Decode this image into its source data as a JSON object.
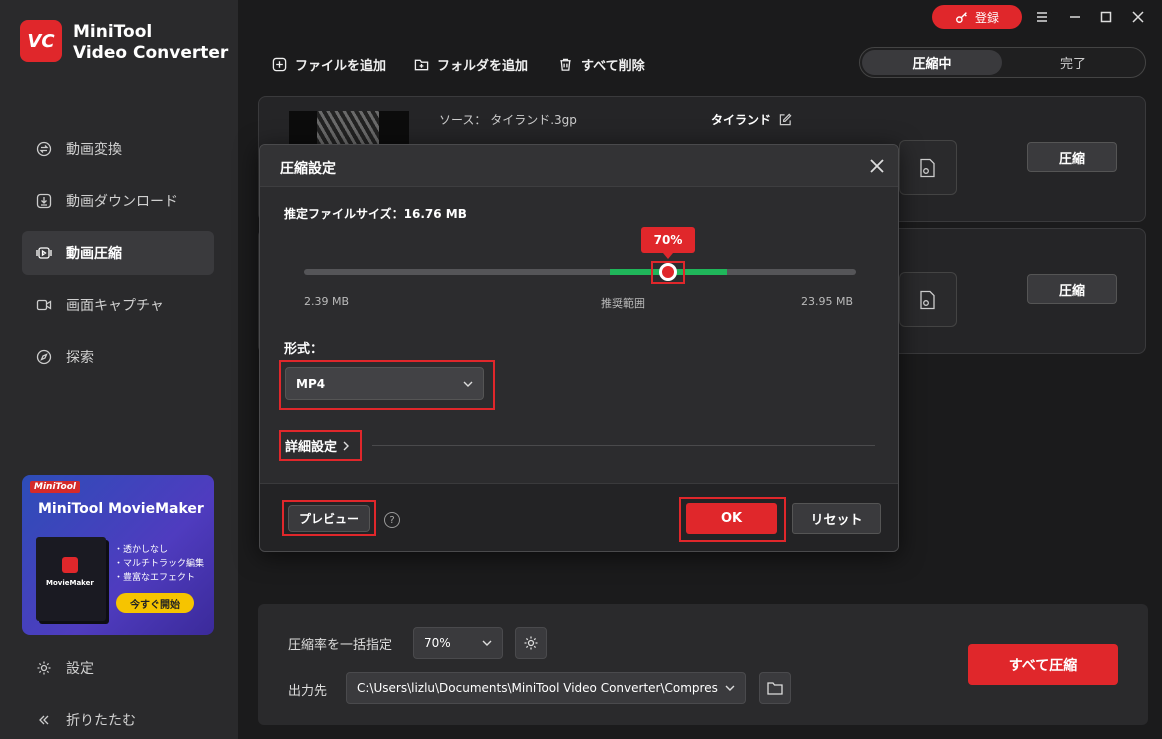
{
  "app": {
    "logo_text": "VC",
    "name_line1": "MiniTool",
    "name_line2": "Video Converter"
  },
  "sidebar": {
    "items": [
      {
        "label": "動画変換",
        "icon": "convert-icon"
      },
      {
        "label": "動画ダウンロード",
        "icon": "download-icon"
      },
      {
        "label": "動画圧縮",
        "icon": "compress-icon",
        "active": true
      },
      {
        "label": "画面キャプチャ",
        "icon": "camera-icon"
      },
      {
        "label": "探索",
        "icon": "compass-icon"
      }
    ],
    "settings_label": "設定",
    "collapse_label": "折りたたむ"
  },
  "promo": {
    "brand": "MiniTool",
    "title": "MiniTool MovieMaker",
    "box_text": "MovieMaker",
    "features": [
      "・透かしなし",
      "・マルチトラック編集",
      "・豊富なエフェクト"
    ],
    "button": "今すぐ開始"
  },
  "titlebar": {
    "register": "登録"
  },
  "toolbar": {
    "add_file": "ファイルを追加",
    "add_folder": "フォルダを追加",
    "delete_all": "すべて削除"
  },
  "tabs": {
    "compressing": "圧縮中",
    "done": "完了"
  },
  "files": [
    {
      "source_label": "ソース：",
      "source": "タイランド.3gp",
      "target": "タイランド",
      "action": "圧縮"
    },
    {
      "action": "圧縮"
    }
  ],
  "bottom": {
    "rate_label": "圧縮率を一括指定",
    "rate_value": "70%",
    "output_label": "出力先",
    "output_path": "C:\\Users\\lizlu\\Documents\\MiniTool Video Converter\\Compres",
    "compress_all": "すべて圧縮"
  },
  "dialog": {
    "title": "圧縮設定",
    "estimated_label": "推定ファイルサイズ：",
    "estimated_size": "16.76 MB",
    "percent": "70%",
    "percent_value": 70,
    "min_size": "2.39 MB",
    "recommended": "推奨範囲",
    "max_size": "23.95 MB",
    "format_label": "形式：",
    "format_value": "MP4",
    "advanced": "詳細設定",
    "preview": "プレビュー",
    "help": "?",
    "ok": "OK",
    "reset": "リセット"
  },
  "colors": {
    "accent": "#e0272b",
    "recommended_range": "#20b65a",
    "background": "#1b1b1c",
    "sidebar": "#2a2a2c"
  }
}
